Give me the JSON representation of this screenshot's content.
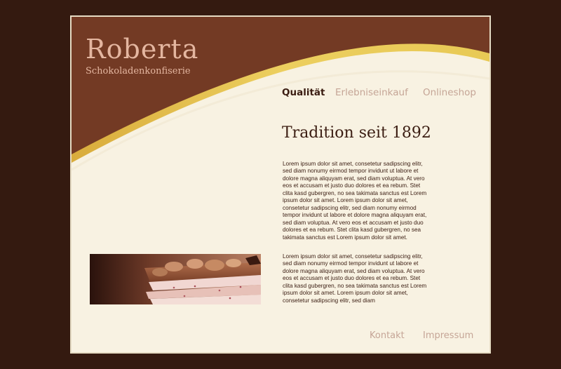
{
  "brand": {
    "name": "Roberta",
    "tagline": "Schokoladenkonfiserie"
  },
  "nav": {
    "items": [
      {
        "label": "Qualität",
        "active": true
      },
      {
        "label": "Erlebniseinkauf",
        "active": false
      },
      {
        "label": "Onlineshop",
        "active": false
      }
    ]
  },
  "main": {
    "headline": "Tradition seit 1892",
    "paragraphs": [
      "Lorem ipsum dolor sit amet, consetetur sadipscing elitr, sed diam nonumy eirmod tempor invidunt ut labore et dolore magna aliquyam erat, sed diam voluptua. At vero eos et accusam et justo duo dolores et ea rebum. Stet clita kasd gubergren, no sea takimata sanctus est Lorem ipsum dolor sit amet. Lorem ipsum dolor sit amet, consetetur sadipscing elitr, sed diam nonumy eirmod tempor invidunt ut labore et dolore magna aliquyam erat, sed diam voluptua. At vero eos et accusam et justo duo dolores et ea rebum. Stet clita kasd gubergren, no sea takimata sanctus est Lorem ipsum dolor sit amet.",
      "Lorem ipsum dolor sit amet, consetetur sadipscing elitr, sed diam nonumy eirmod tempor invidunt ut labore et dolore magna aliquyam erat, sed diam voluptua. At vero eos et accusam et justo duo dolores et ea rebum. Stet clita kasd gubergren, no sea takimata sanctus est Lorem ipsum dolor sit amet. Lorem ipsum dolor sit amet, consetetur sadipscing elitr, sed diam"
    ]
  },
  "footer": {
    "links": [
      "Kontakt",
      "Impressum"
    ]
  },
  "colors": {
    "outer_background": "#341a10",
    "page_background": "#f8f2e2",
    "header_brown": "#733a24",
    "gold_swoosh": "#e8c95a",
    "text_dark": "#3b1d12",
    "text_muted": "#c5a596",
    "brand_text": "#e4b6a0"
  }
}
